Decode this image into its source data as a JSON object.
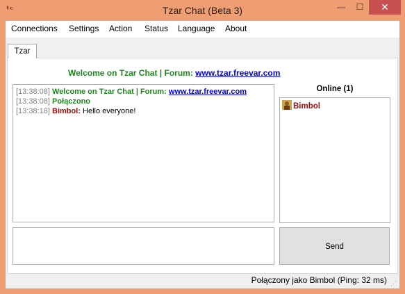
{
  "window": {
    "title": "Tzar Chat (Beta 3)",
    "min_glyph": "—",
    "max_glyph": "☐",
    "close_glyph": "✕",
    "app_icon_glyph": "ᵗᶜ"
  },
  "menu": {
    "items": [
      "Connections",
      "Settings",
      "Action",
      "Status",
      "Language",
      "About"
    ]
  },
  "tabs": [
    {
      "label": "Tzar"
    }
  ],
  "channel": {
    "welcome_text": "Welcome on Tzar Chat | Forum: ",
    "forum_link": "www.tzar.freevar.com"
  },
  "messages": [
    {
      "time": "[13:38:08]",
      "sender": "",
      "text": "Welcome on Tzar Chat | Forum: ",
      "link": "www.tzar.freevar.com"
    },
    {
      "time": "[13:38:08]",
      "sender": "",
      "text": "Połączono",
      "link": ""
    },
    {
      "time": "[13:38:18]",
      "sender": "Bimbol:",
      "text": " Hello everyone!",
      "link": ""
    }
  ],
  "online": {
    "title": "Online (1)",
    "users": [
      {
        "name": "Bimbol",
        "icon": "user-portrait-icon"
      }
    ]
  },
  "input": {
    "value": ""
  },
  "send_label": "Send",
  "status": {
    "text": "Połączony jako Bimbol  (Ping: 32 ms)"
  },
  "colors": {
    "title_bar": "#ee9e72",
    "close_button": "#c75050",
    "system_text": "#1a8a1a",
    "nick": "#a01010",
    "link": "#0000ee"
  }
}
